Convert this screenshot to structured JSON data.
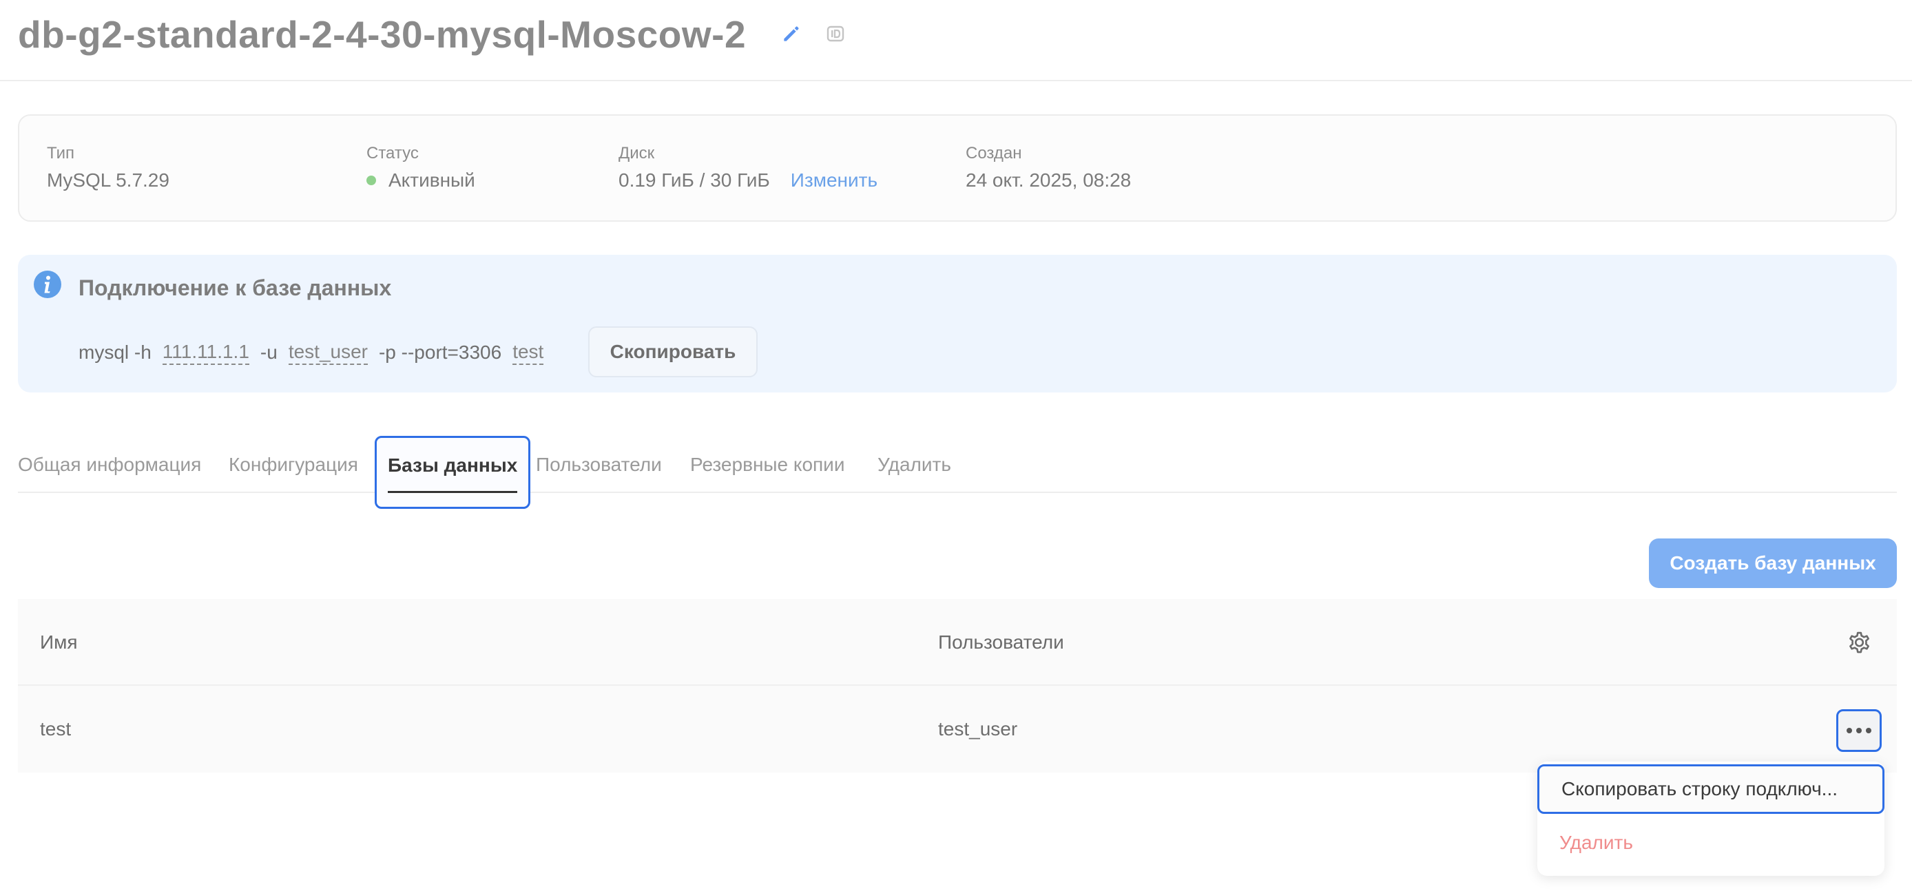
{
  "header": {
    "title": "db-g2-standard-2-4-30-mysql-Moscow-2",
    "edit_icon": "pencil-icon",
    "id_icon": "id-icon",
    "edit_icon_color": "#5a93f0"
  },
  "info": {
    "type_label": "Тип",
    "type_value": "MySQL 5.7.29",
    "status_label": "Статус",
    "status_value": "Активный",
    "status_color": "#8fd18c",
    "disk_label": "Диск",
    "disk_value": "0.19 ГиБ / 30 ГиБ",
    "disk_change": "Изменить",
    "created_label": "Создан",
    "created_value": "24 окт. 2025, 08:28"
  },
  "connection": {
    "title": "Подключение к базе данных",
    "cmd_prefix": "mysql -h",
    "host": "111.11.1.1",
    "user_flag": "-u",
    "user": "test_user",
    "rest": "-p --port=3306",
    "db": "test",
    "copy_label": "Скопировать",
    "info_icon": "info-icon",
    "info_icon_color": "#5e9ee8"
  },
  "tabs": [
    {
      "label": "Общая информация",
      "active": false
    },
    {
      "label": "Конфигурация",
      "active": false
    },
    {
      "label": "Базы данных",
      "active": true
    },
    {
      "label": "Пользователи",
      "active": false
    },
    {
      "label": "Резервные копии",
      "active": false
    },
    {
      "label": "Удалить",
      "active": false
    }
  ],
  "create_button": {
    "label": "Создать базу данных",
    "color": "#7fb0f3"
  },
  "table": {
    "columns": [
      "Имя",
      "Пользователи"
    ],
    "settings_icon": "gear-icon",
    "rows": [
      {
        "name": "test",
        "users": "test_user",
        "more_icon": "more-dots-icon"
      }
    ]
  },
  "menu": {
    "items": [
      {
        "label": "Скопировать строку подключ..."
      },
      {
        "label": "Удалить",
        "color": "#f08c8c"
      }
    ]
  },
  "accent_color": "#2e6ee6"
}
